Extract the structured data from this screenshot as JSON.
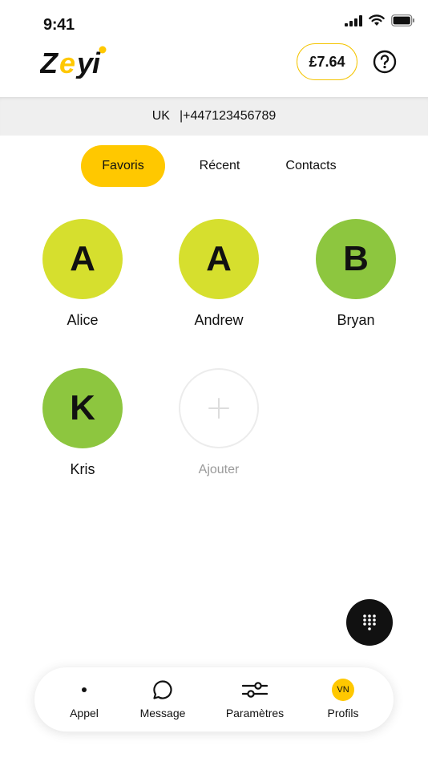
{
  "status_bar": {
    "time": "9:41"
  },
  "header": {
    "logo_text": "Zeyi",
    "balance": "£7.64",
    "help_symbol": "?"
  },
  "number_bar": {
    "country": "UK",
    "number": "|+447123456789"
  },
  "tabs": [
    {
      "label": "Favoris",
      "active": true
    },
    {
      "label": "Récent",
      "active": false
    },
    {
      "label": "Contacts",
      "active": false
    }
  ],
  "favorites": [
    {
      "initial": "A",
      "name": "Alice",
      "color": "#d6df2e"
    },
    {
      "initial": "A",
      "name": "Andrew",
      "color": "#d6df2e"
    },
    {
      "initial": "B",
      "name": "Bryan",
      "color": "#8dc63f"
    },
    {
      "initial": "K",
      "name": "Kris",
      "color": "#8dc63f"
    }
  ],
  "add_favorite": {
    "label": "Ajouter",
    "icon": "plus-icon"
  },
  "dialpad": {
    "icon": "dialpad-icon"
  },
  "bottom_nav": [
    {
      "label": "Appel",
      "icon": "dot-icon"
    },
    {
      "label": "Message",
      "icon": "chat-bubble-icon"
    },
    {
      "label": "Paramètres",
      "icon": "sliders-icon"
    },
    {
      "label": "Profils",
      "icon": "profile-badge",
      "badge": "VN"
    }
  ],
  "colors": {
    "accent": "#ffc800",
    "lime": "#d6df2e",
    "green": "#8dc63f"
  }
}
